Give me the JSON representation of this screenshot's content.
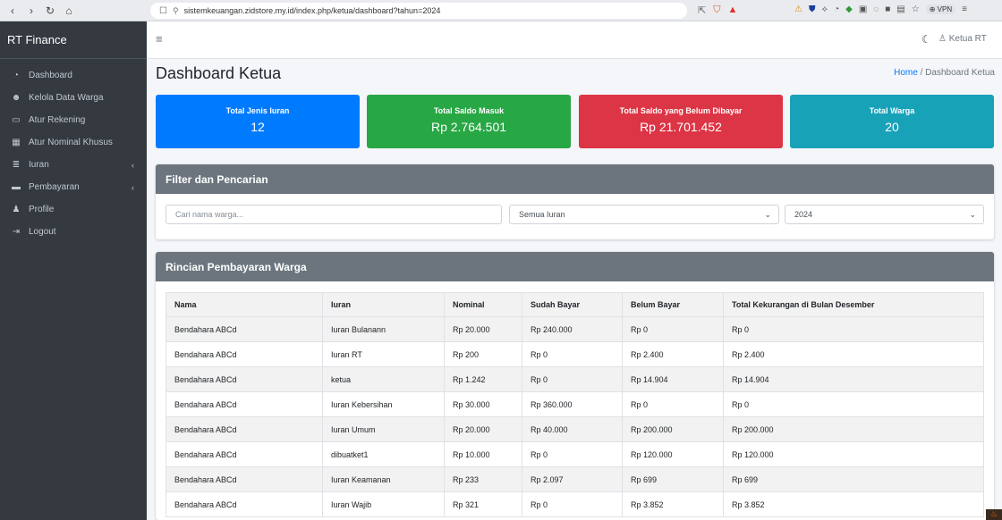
{
  "browser": {
    "url": "sistemkeuangan.zidstore.my.id/index.php/ketua/dashboard?tahun=2024",
    "vpn_label": "VPN"
  },
  "sidebar": {
    "brand": "RT Finance",
    "items": [
      {
        "label": "Dashboard",
        "icon": "dashboard-icon",
        "caret": false
      },
      {
        "label": "Kelola Data Warga",
        "icon": "users-icon",
        "caret": false
      },
      {
        "label": "Atur Rekening",
        "icon": "card-icon",
        "caret": false
      },
      {
        "label": "Atur Nominal Khusus",
        "icon": "calculator-icon",
        "caret": false
      },
      {
        "label": "Iuran",
        "icon": "money-stack-icon",
        "caret": true
      },
      {
        "label": "Pembayaran",
        "icon": "payment-icon",
        "caret": true
      },
      {
        "label": "Profile",
        "icon": "user-icon",
        "caret": false
      },
      {
        "label": "Logout",
        "icon": "logout-icon",
        "caret": false
      }
    ]
  },
  "topnav": {
    "user_label": "Ketua RT"
  },
  "page": {
    "title": "Dashboard Ketua",
    "breadcrumb_home": "Home",
    "breadcrumb_sep": "/",
    "breadcrumb_current": "Dashboard Ketua"
  },
  "stats": [
    {
      "label": "Total Jenis Iuran",
      "value": "12",
      "color": "#007bff"
    },
    {
      "label": "Total Saldo Masuk",
      "value": "Rp 2.764.501",
      "color": "#28a745"
    },
    {
      "label": "Total Saldo yang Belum Dibayar",
      "value": "Rp 21.701.452",
      "color": "#dc3545"
    },
    {
      "label": "Total Warga",
      "value": "20",
      "color": "#17a2b8"
    }
  ],
  "filter": {
    "title": "Filter dan Pencarian",
    "search_placeholder": "Cari nama warga...",
    "iuran_selected": "Semua Iuran",
    "year_selected": "2024"
  },
  "table": {
    "title": "Rincian Pembayaran Warga",
    "columns": [
      "Nama",
      "Iuran",
      "Nominal",
      "Sudah Bayar",
      "Belum Bayar",
      "Total Kekurangan di Bulan Desember"
    ],
    "rows": [
      [
        "Bendahara ABCd",
        "Iuran Bulanann",
        "Rp 20.000",
        "Rp 240.000",
        "Rp 0",
        "Rp 0"
      ],
      [
        "Bendahara ABCd",
        "Iuran RT",
        "Rp 200",
        "Rp 0",
        "Rp 2.400",
        "Rp 2.400"
      ],
      [
        "Bendahara ABCd",
        "ketua",
        "Rp 1.242",
        "Rp 0",
        "Rp 14.904",
        "Rp 14.904"
      ],
      [
        "Bendahara ABCd",
        "Iuran Kebersihan",
        "Rp 30.000",
        "Rp 360.000",
        "Rp 0",
        "Rp 0"
      ],
      [
        "Bendahara ABCd",
        "Iuran Umum",
        "Rp 20.000",
        "Rp 40.000",
        "Rp 200.000",
        "Rp 200.000"
      ],
      [
        "Bendahara ABCd",
        "dibuatket1",
        "Rp 10.000",
        "Rp 0",
        "Rp 120.000",
        "Rp 120.000"
      ],
      [
        "Bendahara ABCd",
        "Iuran Keamanan",
        "Rp 233",
        "Rp 2.097",
        "Rp 699",
        "Rp 699"
      ],
      [
        "Bendahara ABCd",
        "Iuran Wajib",
        "Rp 321",
        "Rp 0",
        "Rp 3.852",
        "Rp 3.852"
      ]
    ]
  }
}
